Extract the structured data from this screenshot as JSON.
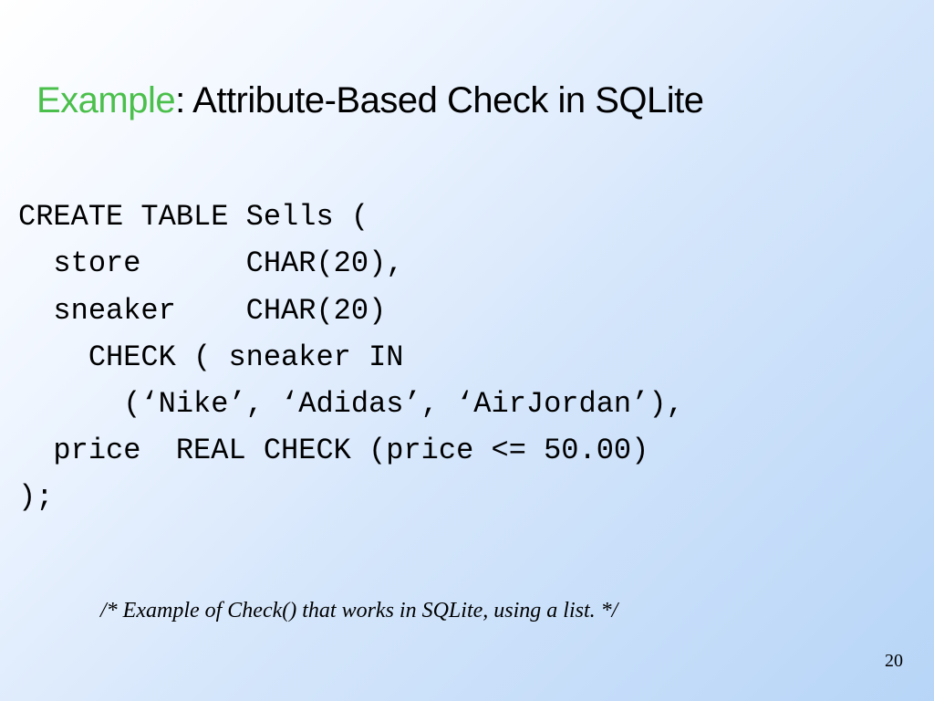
{
  "title": {
    "accent": "Example",
    "rest": ": Attribute-Based Check in SQLite"
  },
  "code": {
    "line1": "CREATE TABLE Sells (",
    "line2": "  store      CHAR(20),",
    "line3": "  sneaker    CHAR(20)",
    "line4": "    CHECK ( sneaker IN",
    "line5": "      (‘Nike’, ‘Adidas’, ‘AirJordan’),",
    "line6": "  price  REAL CHECK (price <= 50.00)",
    "line7": ");"
  },
  "footnote": "/* Example of Check() that works in SQLite, using a list. */",
  "page_number": "20"
}
